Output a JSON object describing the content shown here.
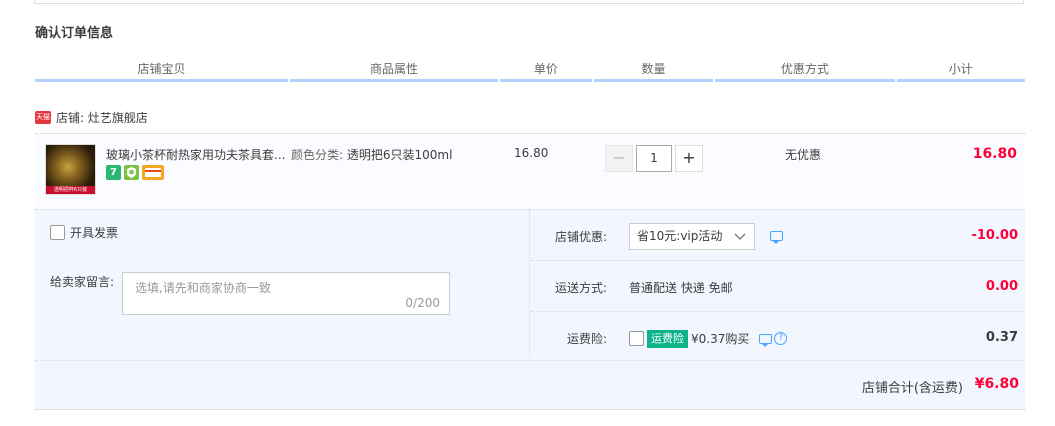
{
  "section_title": "确认订单信息",
  "columns": [
    "店铺宝贝",
    "商品属性",
    "单价",
    "数量",
    "优惠方式",
    "小计"
  ],
  "shop": {
    "icon_label": "天猫",
    "label": "店铺: 灶艺旗舰店"
  },
  "item": {
    "title": "玻璃小茶杯耐热家用功夫茶具套...",
    "attr_label": "颜色分类:",
    "attr_value": "透明把6只装100ml",
    "price": "16.80",
    "quantity": "1",
    "promotion": "无优惠",
    "subtotal": "16.80",
    "image_caption": "透明把杯6只装",
    "badges": [
      {
        "icon": "seven-day-return-icon",
        "text": "7",
        "color": "#2bb673"
      },
      {
        "icon": "shield-icon",
        "text": "保",
        "color": "#2bb673"
      },
      {
        "icon": "card-icon",
        "text": "",
        "color": "#f5a623"
      }
    ]
  },
  "invoice_label": "开具发票",
  "memo": {
    "label": "给卖家留言:",
    "placeholder": "选填,请先和商家协商一致",
    "counter": "0/200"
  },
  "discount": {
    "label": "店铺优惠:",
    "selected": "省10元:vip活动",
    "value": "-10.00"
  },
  "shipping": {
    "label": "运送方式:",
    "method": "普通配送 快递 免邮",
    "value": "0.00"
  },
  "insurance": {
    "label": "运费险:",
    "tag": "运费险",
    "price_text": "¥0.37购买",
    "value": "0.37"
  },
  "total": {
    "label": "店铺合计(含运费)",
    "value": "¥6.80"
  },
  "colors": {
    "accent_red": "#ff0036",
    "header_line": "#b2d1ff",
    "panel_bg": "#f2f7ff",
    "insurance_green": "#0db28b"
  }
}
